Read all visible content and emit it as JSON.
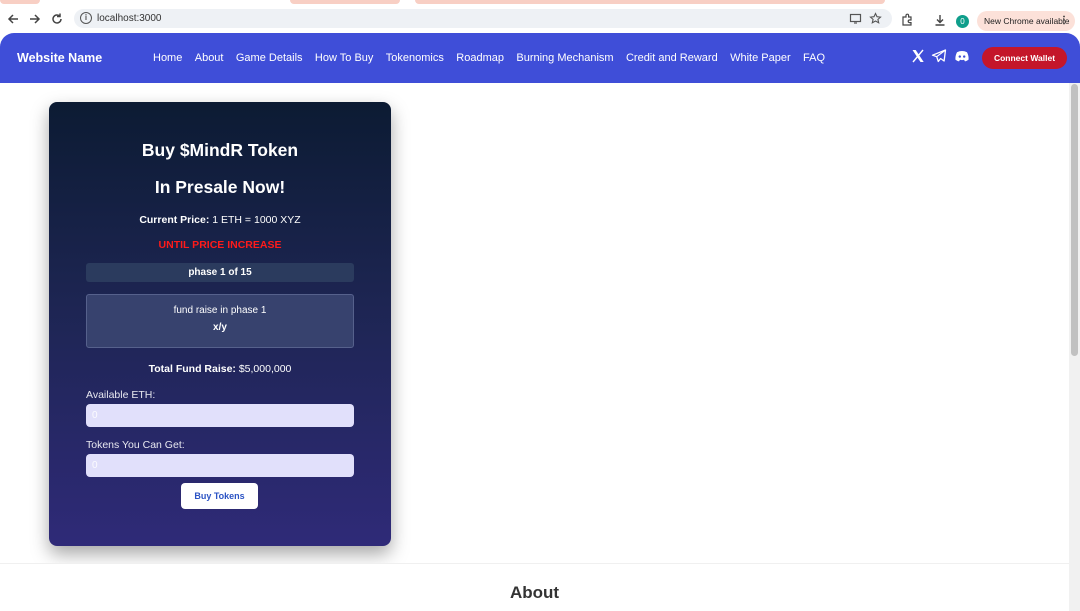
{
  "browser": {
    "url": "localhost:3000",
    "profile_initial": "0",
    "update_label": "New Chrome available"
  },
  "navbar": {
    "brand": "Website Name",
    "links": [
      "Home",
      "About",
      "Game Details",
      "How To Buy",
      "Tokenomics",
      "Roadmap",
      "Burning Mechanism",
      "Credit and Reward",
      "White Paper",
      "FAQ"
    ],
    "connect_label": "Connect Wallet",
    "social_icons": [
      "x-icon",
      "telegram-icon",
      "discord-icon"
    ]
  },
  "presale": {
    "title": "Buy $MindR Token",
    "subtitle": "In Presale Now!",
    "price_label": "Current Price:",
    "price_value": " 1 ETH = 1000 XYZ",
    "until_label": "UNTIL PRICE INCREASE",
    "phase_label": "phase 1 of 15",
    "fund_label": "fund raise in phase 1",
    "fund_value": "x/y",
    "total_label": "Total Fund Raise:",
    "total_value": " $5,000,000",
    "eth_label": "Available ETH:",
    "eth_placeholder": "0",
    "tokens_label": "Tokens You Can Get:",
    "tokens_placeholder": "0",
    "buy_label": "Buy Tokens"
  },
  "about": {
    "heading": "About"
  },
  "colors": {
    "navbar": "#3f4ed8",
    "connect": "#c4162a",
    "warning": "#ff1a1a"
  }
}
